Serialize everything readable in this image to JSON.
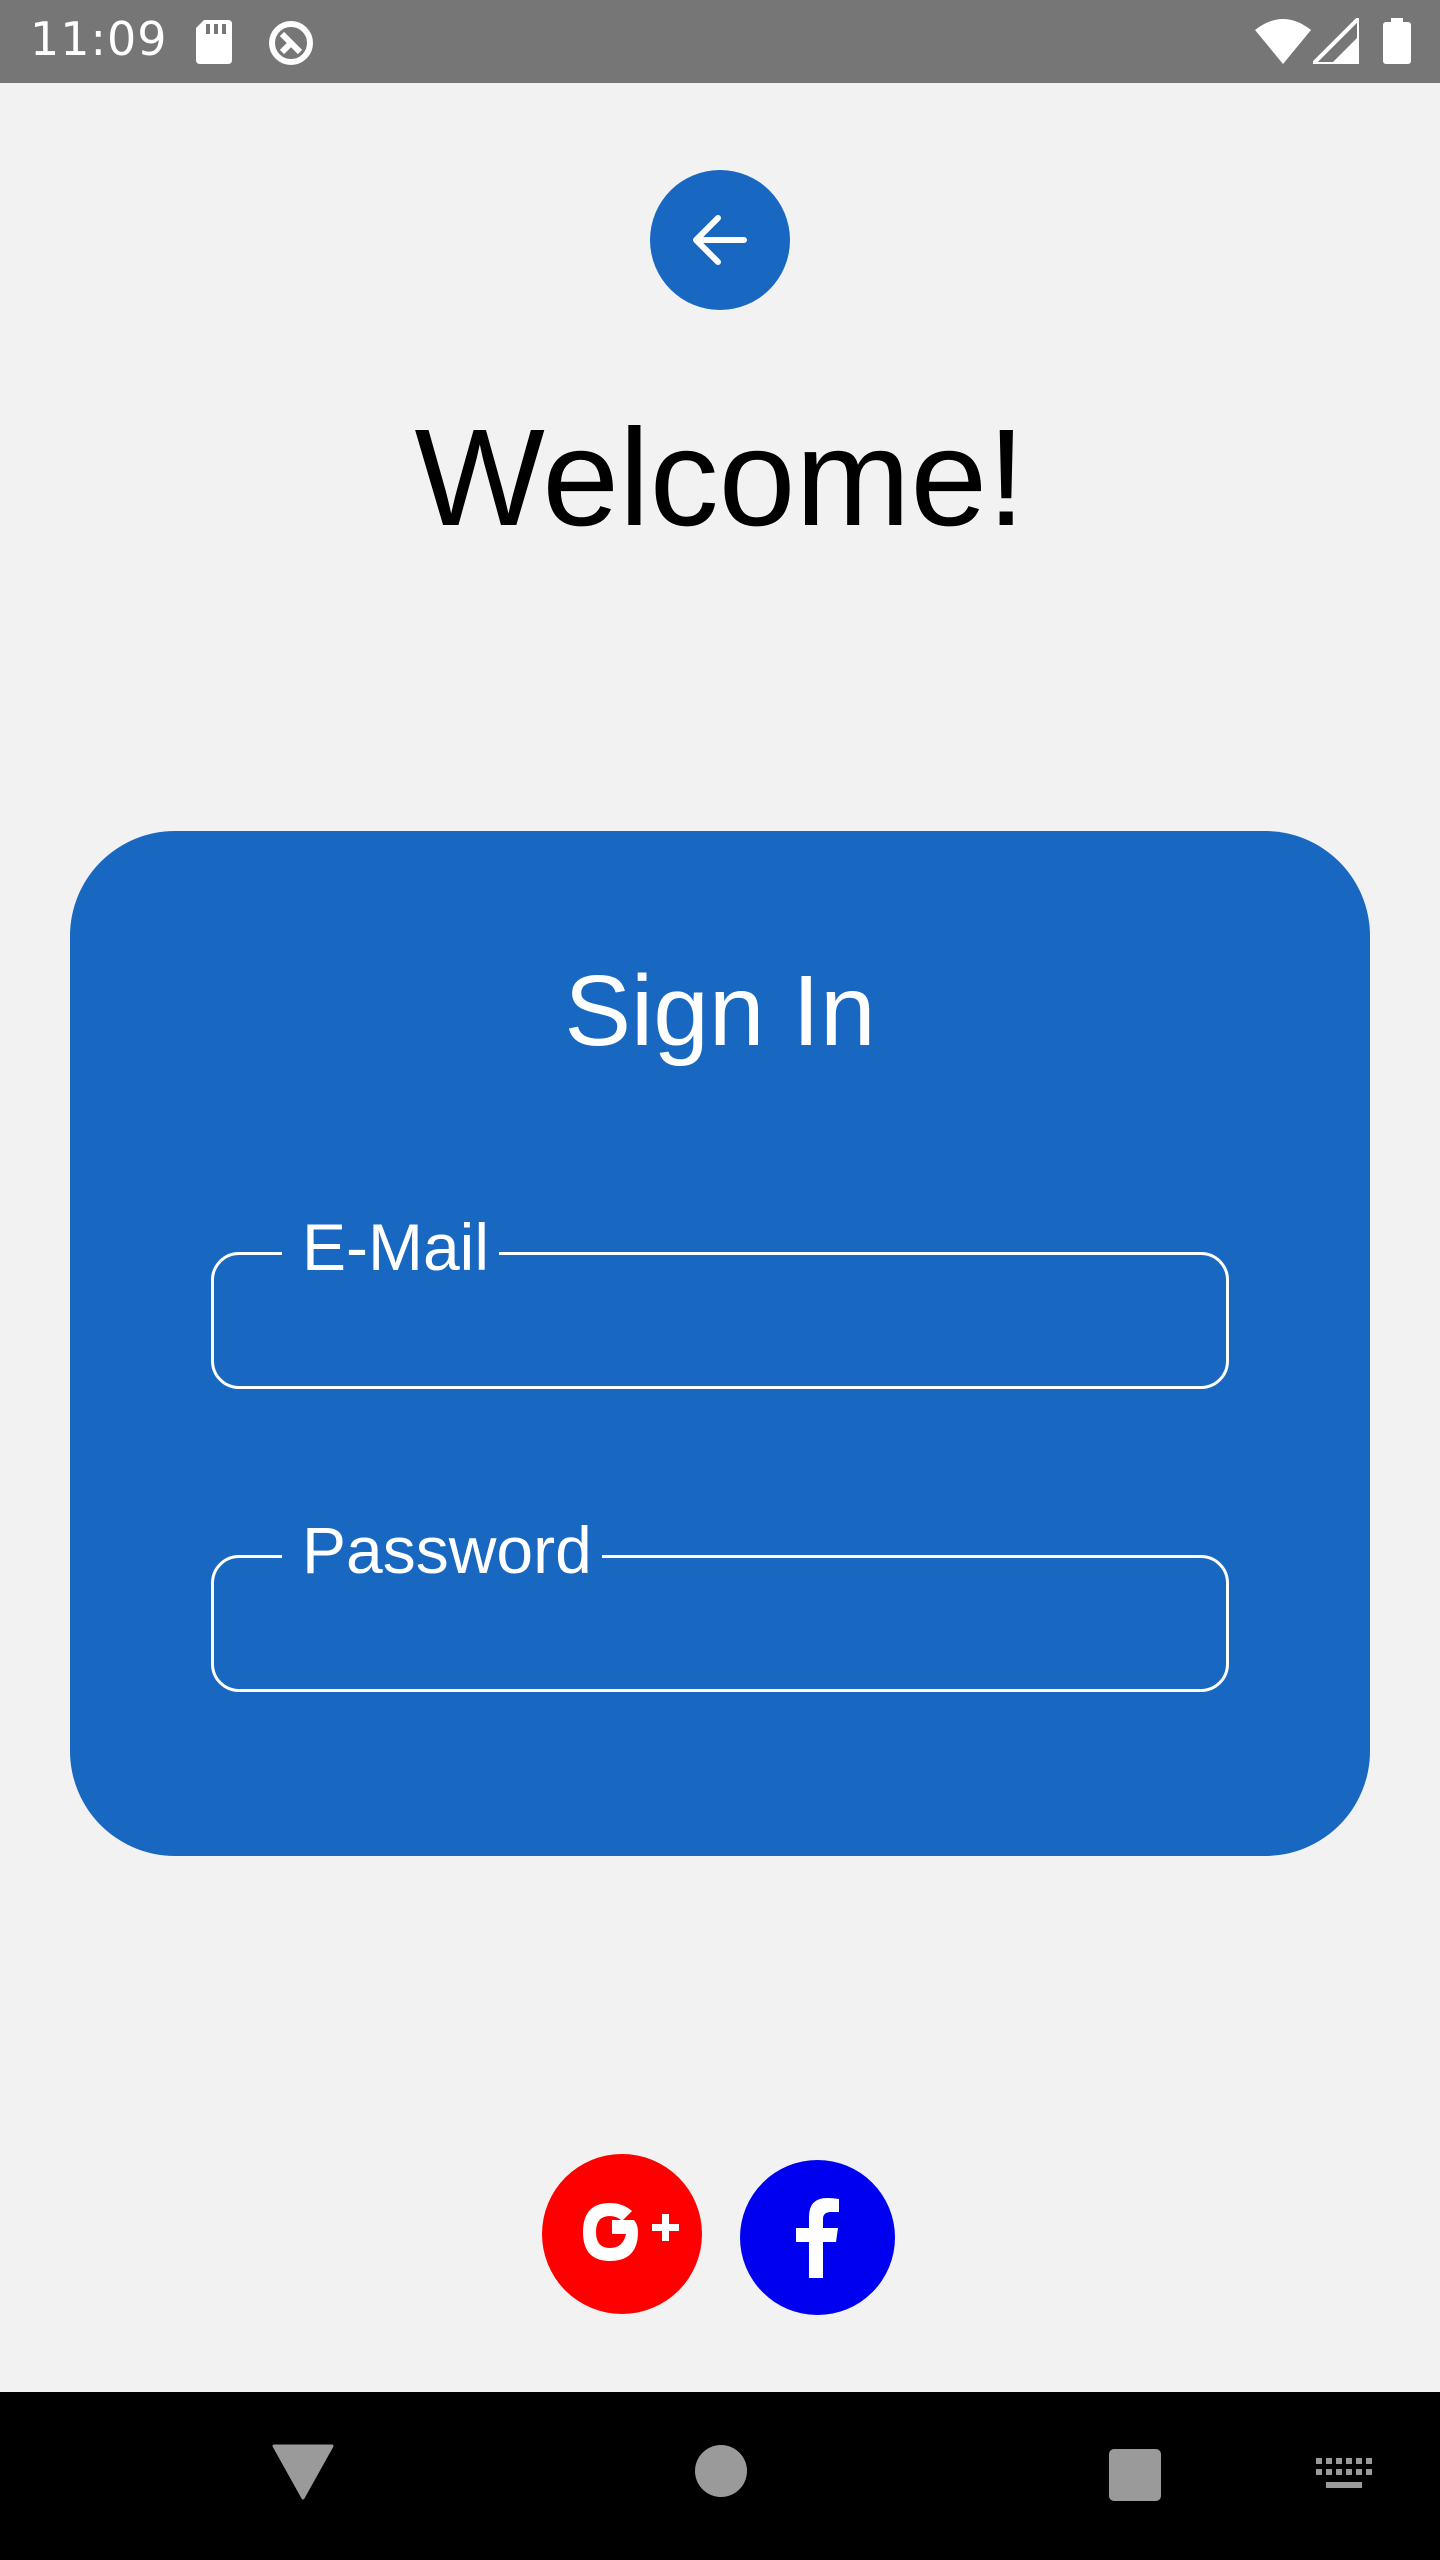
{
  "status_bar": {
    "time": "11:09",
    "icons": [
      "sd-card-icon",
      "sync-icon",
      "wifi-icon",
      "signal-icon",
      "battery-icon"
    ]
  },
  "header": {
    "back_icon": "arrow-left-icon",
    "title": "Welcome!"
  },
  "signin": {
    "title": "Sign In",
    "email": {
      "label": "E-Mail",
      "value": "",
      "placeholder": ""
    },
    "password": {
      "label": "Password",
      "value": "",
      "placeholder": ""
    }
  },
  "social": {
    "google": {
      "label": "G+",
      "color": "#ff0000"
    },
    "facebook": {
      "label": "f",
      "color": "#0000f0"
    }
  },
  "colors": {
    "primary": "#1867c0",
    "background": "#f2f2f3",
    "status_bar": "#767676",
    "nav_bar": "#000000"
  },
  "nav_bar": {
    "icons": [
      "back-icon",
      "home-icon",
      "recent-apps-icon",
      "keyboard-icon"
    ]
  }
}
